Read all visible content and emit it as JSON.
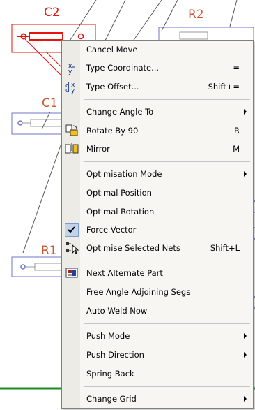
{
  "schematic": {
    "components": [
      {
        "ref": "C2",
        "color": "#e8130d"
      },
      {
        "ref": "R2",
        "color": "#c85a34"
      },
      {
        "ref": "C1",
        "color": "#c85a34"
      },
      {
        "ref": "R1",
        "color": "#c85a34"
      }
    ],
    "colors": {
      "selected": "#e8130d",
      "part": "#6c74c8",
      "track": "#1e8a1e",
      "ratsnest": "#555555"
    }
  },
  "context_menu": {
    "items": [
      {
        "label": "Cancel Move",
        "shortcut": "",
        "submenu": false,
        "icon": ""
      },
      {
        "label": "Type Coordinate...",
        "shortcut": "=",
        "submenu": false,
        "icon": "type-coordinate-icon"
      },
      {
        "label": "Type Offset...",
        "shortcut": "Shift+=",
        "submenu": false,
        "icon": "type-offset-icon"
      },
      {
        "label": "Change Angle To",
        "shortcut": "",
        "submenu": true,
        "icon": ""
      },
      {
        "label": "Rotate By 90",
        "shortcut": "R",
        "submenu": false,
        "icon": "rotate-icon"
      },
      {
        "label": "Mirror",
        "shortcut": "M",
        "submenu": false,
        "icon": "mirror-icon"
      },
      {
        "label": "Optimisation Mode",
        "shortcut": "",
        "submenu": true,
        "icon": ""
      },
      {
        "label": "Optimal Position",
        "shortcut": "",
        "submenu": false,
        "icon": ""
      },
      {
        "label": "Optimal Rotation",
        "shortcut": "",
        "submenu": false,
        "icon": ""
      },
      {
        "label": "Force Vector",
        "shortcut": "",
        "submenu": false,
        "icon": "checkmark-icon",
        "checked": true
      },
      {
        "label": "Optimise Selected Nets",
        "shortcut": "Shift+L",
        "submenu": false,
        "icon": "optimise-nets-icon"
      },
      {
        "label": "Next Alternate Part",
        "shortcut": "",
        "submenu": false,
        "icon": "alternate-part-icon"
      },
      {
        "label": "Free Angle Adjoining Segs",
        "shortcut": "",
        "submenu": false,
        "icon": ""
      },
      {
        "label": "Auto Weld Now",
        "shortcut": "",
        "submenu": false,
        "icon": ""
      },
      {
        "label": "Push Mode",
        "shortcut": "",
        "submenu": true,
        "icon": ""
      },
      {
        "label": "Push Direction",
        "shortcut": "",
        "submenu": true,
        "icon": ""
      },
      {
        "label": "Spring Back",
        "shortcut": "",
        "submenu": false,
        "icon": ""
      },
      {
        "label": "Change Grid",
        "shortcut": "",
        "submenu": true,
        "icon": ""
      }
    ]
  }
}
